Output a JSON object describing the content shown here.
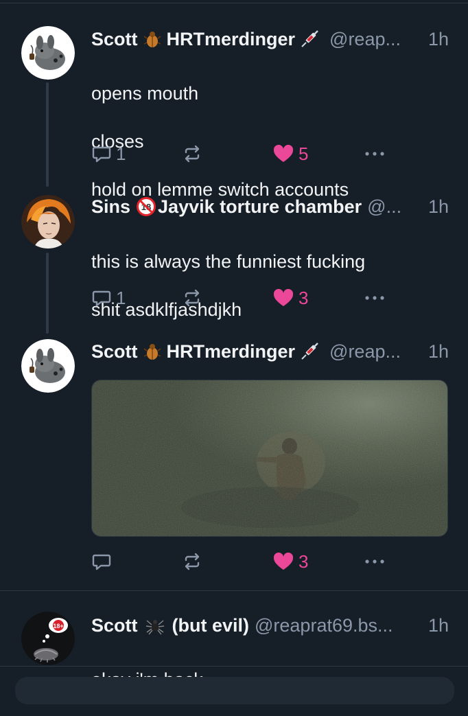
{
  "posts": [
    {
      "author": {
        "name_a": "Scott",
        "name_b": "HRTmerdinger",
        "emoji_a": "beetle-emoji",
        "emoji_b": "syringe-emoji"
      },
      "handle": "@reap...",
      "time": "1h",
      "lines": [
        "opens mouth",
        "closes",
        "hold on lemme switch accounts"
      ],
      "reply_count": "1",
      "like_count": "5",
      "liked": true
    },
    {
      "author": {
        "name_a": "Sins",
        "name_b": "Jayvik torture chamber",
        "emoji_a": "no-18-emoji"
      },
      "handle": "@...",
      "time": "1h",
      "lines": [
        "this is always the funniest fucking",
        "shit asdklfjashdjkh"
      ],
      "reply_count": "1",
      "like_count": "3",
      "liked": true
    },
    {
      "author": {
        "name_a": "Scott",
        "name_b": "HRTmerdinger",
        "emoji_a": "beetle-emoji",
        "emoji_b": "syringe-emoji"
      },
      "handle": "@reap...",
      "time": "1h",
      "media": "dark-foggy-video-thumbnail",
      "reply_count": "",
      "like_count": "3",
      "liked": true
    },
    {
      "author": {
        "name_a": "Scott",
        "name_b": "(but evil)",
        "emoji_a": "spider-emoji"
      },
      "handle": "@reaprat69.bs...",
      "time": "1h",
      "lines": [
        "okay i'm back"
      ],
      "avatar_badge": "18+"
    }
  ],
  "colors": {
    "background": "#161e27",
    "text": "#f1f3f5",
    "muted": "#8b98a9",
    "accent": "#1d8cf0",
    "like": "#ec4899"
  }
}
